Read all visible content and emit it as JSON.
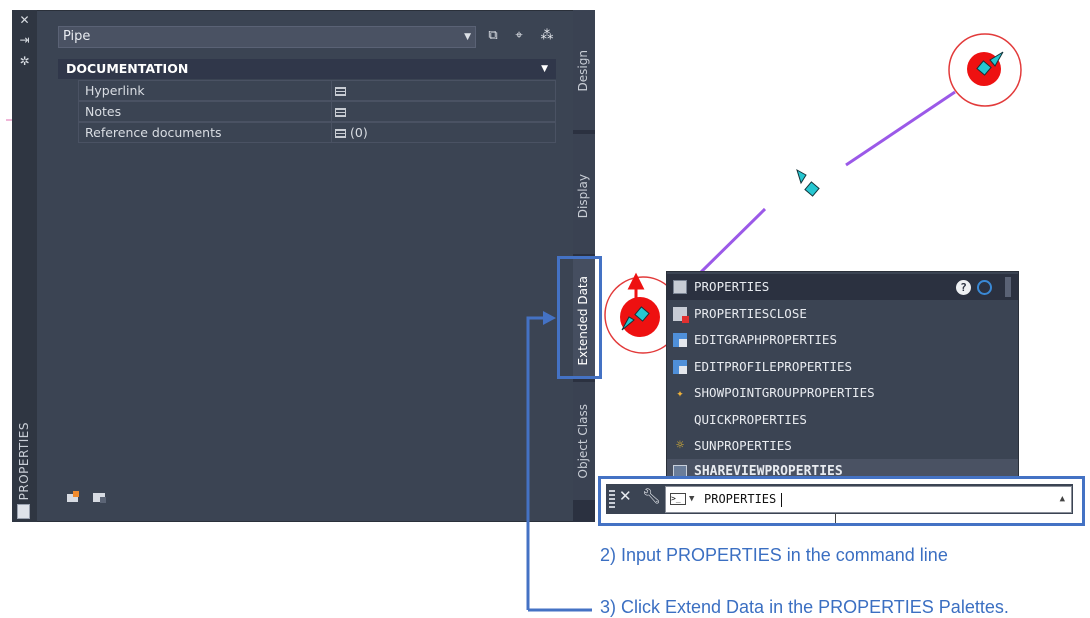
{
  "palette": {
    "side_title": "PROPERTIES",
    "object_type": "Pipe",
    "section": "DOCUMENTATION",
    "rows": [
      {
        "label": "Hyperlink",
        "value": ""
      },
      {
        "label": "Notes",
        "value": ""
      },
      {
        "label": "Reference documents",
        "value": "(0)"
      }
    ],
    "tabs": [
      "Design",
      "Display",
      "Extended Data",
      "Object Class"
    ]
  },
  "autocomplete": {
    "items": [
      "PROPERTIES",
      "PROPERTIESCLOSE",
      "EDITGRAPHPROPERTIES",
      "EDITPROFILEPROPERTIES",
      "SHOWPOINTGROUPPROPERTIES",
      "QUICKPROPERTIES",
      "SUNPROPERTIES",
      "SHAREVIEWPROPERTIES"
    ]
  },
  "command_line": {
    "value": "PROPERTIES"
  },
  "annotations": {
    "step2": "2) Input PROPERTIES in the command line",
    "step3": "3) Click Extend Data in the PROPERTIES Palettes."
  },
  "colors": {
    "highlight": "#4472c4",
    "grip_red": "#ee1111",
    "pipe_line": "#9b59e8",
    "marker": "#26c7d1"
  },
  "icons": [
    "close-icon",
    "pin-icon",
    "settings-icon",
    "quick-select-icon",
    "select-objects-icon",
    "toggle-pickadd-icon",
    "help-icon",
    "search-web-icon",
    "wrench-icon",
    "terminal-icon"
  ]
}
